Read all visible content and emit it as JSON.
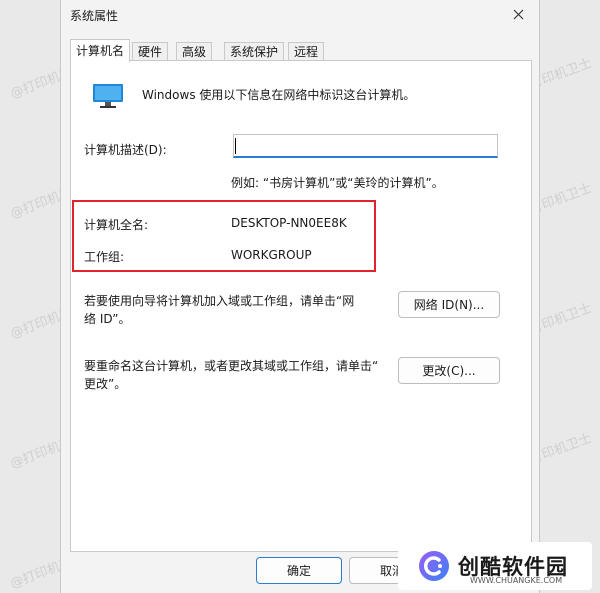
{
  "window": {
    "title": "系统属性"
  },
  "tabs": [
    {
      "label": "计算机名",
      "active": true
    },
    {
      "label": "硬件",
      "active": false
    },
    {
      "label": "高级",
      "active": false
    },
    {
      "label": "系统保护",
      "active": false
    },
    {
      "label": "远程",
      "active": false
    }
  ],
  "panel": {
    "intro": "Windows 使用以下信息在网络中标识这台计算机。",
    "description_label": "计算机描述(D):",
    "description_value": "",
    "example": "例如: “书房计算机”或“美玲的计算机”。",
    "full_name_label": "计算机全名:",
    "full_name_value": "DESKTOP-NN0EE8K",
    "workgroup_label": "工作组:",
    "workgroup_value": "WORKGROUP",
    "network_text_line1": "若要使用向导将计算机加入域或工作组，请单击“网",
    "network_text_line2": "络 ID”。",
    "network_button": "网络 ID(N)...",
    "rename_text_line1": "要重命名这台计算机，或者更改其域或工作组，请单击“",
    "rename_text_line2": "更改”。",
    "change_button": "更改(C)..."
  },
  "footer": {
    "ok_button": "确定",
    "cancel_button": "取消"
  },
  "watermark": {
    "text": "@打印机卫士"
  },
  "logo": {
    "name": "创酷软件园",
    "url": "WWW.CHUANGKE.COM"
  },
  "colors": {
    "highlight": "#e0242a",
    "accent": "#2b7bd1",
    "monitor": "#1e88d8"
  }
}
